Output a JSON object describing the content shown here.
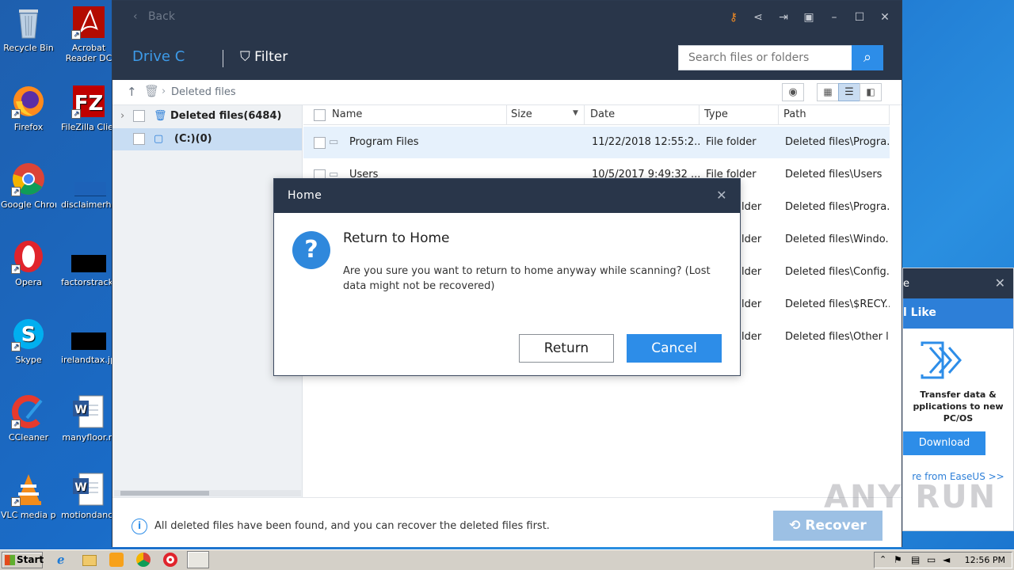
{
  "desktop": {
    "icons": [
      {
        "label": "Recycle Bin"
      },
      {
        "label": "Acrobat Reader DC"
      },
      {
        "label": "Firefox"
      },
      {
        "label": "FileZilla Client"
      },
      {
        "label": "Google Chrome"
      },
      {
        "label": "disclaimerhe..."
      },
      {
        "label": "Opera"
      },
      {
        "label": "factorstrack..."
      },
      {
        "label": "Skype"
      },
      {
        "label": "irelandtax.jpg"
      },
      {
        "label": "CCleaner"
      },
      {
        "label": "manyfloor.rt"
      },
      {
        "label": "VLC media player"
      },
      {
        "label": "motiondanc..."
      }
    ]
  },
  "app": {
    "back_label": "Back",
    "drive_label": "Drive C",
    "filter_label": "Filter",
    "search_placeholder": "Search files or folders",
    "breadcrumb": "Deleted files",
    "tree": [
      {
        "label": "Deleted files(6484)"
      },
      {
        "label": "(C:)(0)"
      }
    ],
    "columns": {
      "name": "Name",
      "size": "Size",
      "date": "Date",
      "type": "Type",
      "path": "Path"
    },
    "rows": [
      {
        "name": "Program Files",
        "date": "11/22/2018 12:55:2...",
        "type": "File folder",
        "path": "Deleted files\\Progra..."
      },
      {
        "name": "Users",
        "date": "10/5/2017 9:49:32 ...",
        "type": "File folder",
        "path": "Deleted files\\Users"
      },
      {
        "name": "",
        "date": "",
        "type": "lder",
        "path": "Deleted files\\Progra..."
      },
      {
        "name": "",
        "date": "",
        "type": "lder",
        "path": "Deleted files\\Windo..."
      },
      {
        "name": "",
        "date": "",
        "type": "lder",
        "path": "Deleted files\\Config..."
      },
      {
        "name": "",
        "date": "",
        "type": "lder",
        "path": "Deleted files\\$RECY..."
      },
      {
        "name": "",
        "date": "",
        "type": "lder",
        "path": "Deleted files\\Other l..."
      }
    ],
    "status_text": "All deleted files have been found, and you can recover the deleted files first.",
    "recover_label": "Recover"
  },
  "dialog": {
    "title": "Home",
    "heading": "Return to Home",
    "message": "Are you sure you want to return to home anyway while scanning? (Lost data might not be recovered)",
    "return_label": "Return",
    "cancel_label": "Cancel"
  },
  "side_panel": {
    "title_fragment": "e",
    "heading": "l Like",
    "text": "Transfer data & pplications to new PC/OS",
    "download_label": "Download",
    "more_link": "re from EaseUS >>"
  },
  "taskbar": {
    "start_label": "Start",
    "clock": "12:56 PM"
  },
  "watermark": "ANY RUN",
  "colors": {
    "accent": "#2d8de8",
    "titlebar": "#29364a"
  }
}
